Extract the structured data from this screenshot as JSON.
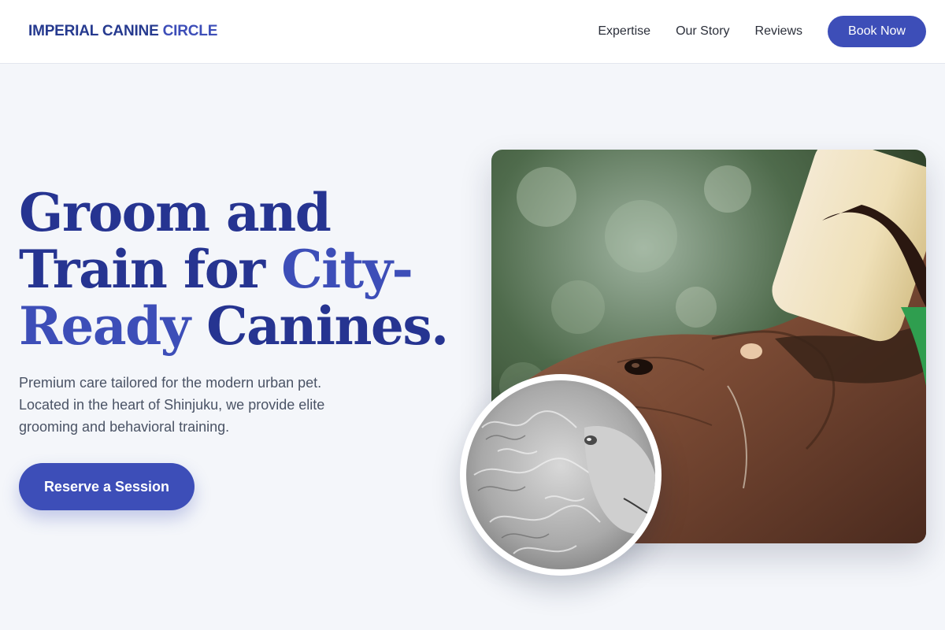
{
  "brand": {
    "name_part1": "IMPERIAL CANINE",
    "name_part2": "CIRCLE"
  },
  "nav": {
    "links": [
      "Expertise",
      "Our Story",
      "Reviews"
    ],
    "cta": "Book Now"
  },
  "hero": {
    "headline_part1": "Groom and Train for",
    "headline_highlight1": "City-",
    "headline_highlight2": "Ready",
    "headline_part2": "Canines.",
    "subtext": "Premium care tailored for the modern urban pet. Located in the heart of Shinjuku, we provide elite grooming and behavioral training.",
    "cta": "Reserve a Session"
  },
  "images": {
    "main": "elephant-bottle-feeding-photo",
    "inset": "sheep-black-and-white-photo"
  },
  "colors": {
    "accent": "#3d4eb8",
    "headline": "#263491",
    "background": "#f4f6fa",
    "body_text": "#4a5365"
  }
}
